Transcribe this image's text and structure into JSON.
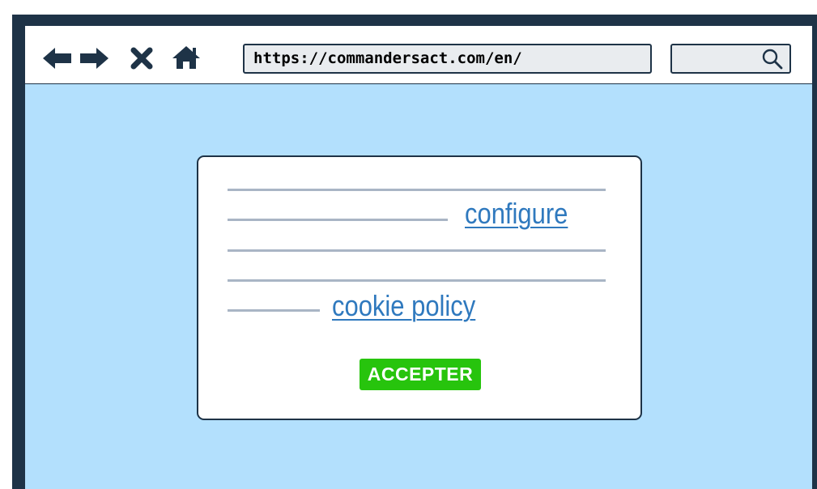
{
  "browser": {
    "url": "https://commandersact.com/en/",
    "toolbar_icons": [
      "back-arrow-icon",
      "forward-arrow-icon",
      "close-icon",
      "home-icon"
    ],
    "search_icon": "search-icon"
  },
  "cookie_dialog": {
    "configure_link": "configure",
    "cookie_policy_link": "cookie policy",
    "accept_button": "ACCEPTER"
  },
  "colors": {
    "frame": "#1e3347",
    "viewport": "#b3e0fd",
    "placeholder_line": "#a9b5c5",
    "link": "#2f79be",
    "accept": "#27c40d"
  }
}
